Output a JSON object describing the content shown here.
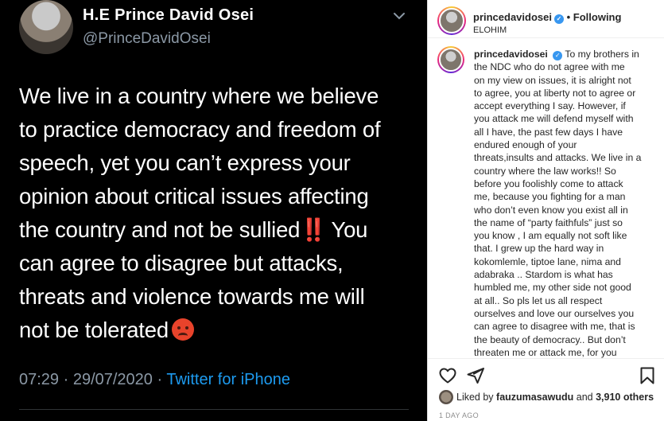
{
  "tweet": {
    "display_name": "H.E Prince David Osei",
    "handle": "@PrinceDavidOsei",
    "lines": [
      "We live in a country where we believe",
      "to practice democracy and freedom of",
      "speech, yet you can’t express your",
      "opinion about critical issues affecting",
      "the country and not be sullied",
      "can agree to disagree but attacks,",
      "threats and violence towards me will",
      "not be tolerated"
    ],
    "line5_marks": "‼️",
    "line5_tail": " You",
    "time": "07:29 · 29/07/2020 · ",
    "source": "Twitter for iPhone",
    "colors": {
      "background": "#000000",
      "text": "#ffffff",
      "muted": "#8b98a5",
      "link": "#1d9bf0"
    }
  },
  "instagram": {
    "username": "princedavidosei",
    "follow_status": "Following",
    "location": "ELOHIM",
    "caption_user": "princedavidosei",
    "caption_lines": [
      "To my brothers in",
      "the NDC who do not agree with me",
      "on my view on issues, it is alright not",
      "to agree, you at liberty not to agree or",
      "accept everything I say. However, if",
      "you attack me will defend myself with",
      "all I have, the past few days I have",
      "endured enough of your",
      "threats,insults and attacks. We live in a",
      "country where the law works!! So",
      "before you foolishly come to attack",
      "me, because you fighting for a man",
      "who don’t even know you exist all in",
      "the name of “party faithfuls” just so",
      "you know , I am equally not soft like",
      "that. I grew up the hard way in",
      "kokomlemle, tiptoe lane, nima and",
      "adabraka .. Stardom is what has",
      "humbled me, my other side not good",
      "at all.. So pls let us all respect",
      "ourselves and love our ourselves you",
      "can agree to disagree with me, that is",
      "the beauty of democracy.. But don’t",
      "threaten me or attack me, for you"
    ],
    "liked_prefix": "Liked by ",
    "liked_user": "fauzumasawudu",
    "liked_mid": " and ",
    "liked_count": "3,910 others",
    "time_ago": "1 DAY AGO",
    "icons": [
      "heart-icon",
      "share-icon",
      "bookmark-icon",
      "verified-icon",
      "chevron-down-icon"
    ],
    "colors": {
      "text": "#262626",
      "muted": "#8e8e8e",
      "verified": "#3897f0"
    }
  }
}
